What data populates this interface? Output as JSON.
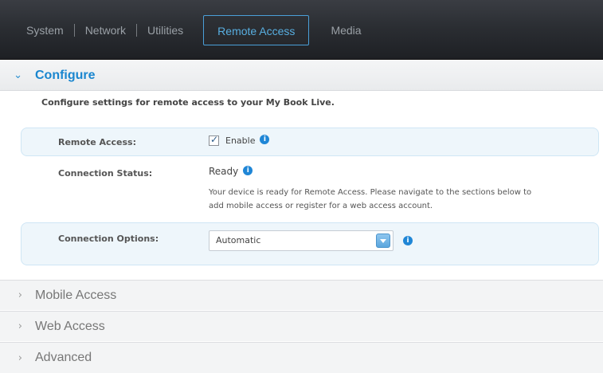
{
  "nav": {
    "tabs": [
      {
        "label": "System"
      },
      {
        "label": "Network"
      },
      {
        "label": "Utilities"
      },
      {
        "label": "Remote Access"
      },
      {
        "label": "Media"
      }
    ],
    "active_tab": "Remote Access"
  },
  "configure": {
    "title": "Configure",
    "intro": "Configure settings for remote access to your My Book Live.",
    "remote_access": {
      "label": "Remote Access:",
      "checkbox_label": "Enable",
      "checked": true
    },
    "connection_status": {
      "label": "Connection Status:",
      "value": "Ready",
      "description_line1": "Your device is ready for Remote Access. Please navigate to the sections below to",
      "description_line2": "add mobile access or register for a web access account."
    },
    "connection_options": {
      "label": "Connection Options:",
      "selected": "Automatic"
    }
  },
  "sections": {
    "mobile_access": "Mobile Access",
    "web_access": "Web Access",
    "advanced": "Advanced"
  },
  "icons": {
    "info": "i",
    "expanded_chevron": "⌄",
    "collapsed_chevron": "›"
  },
  "colors": {
    "accent": "#1a86cf",
    "nav_bg": "#2b2e33",
    "row_highlight": "#eef6fb"
  }
}
